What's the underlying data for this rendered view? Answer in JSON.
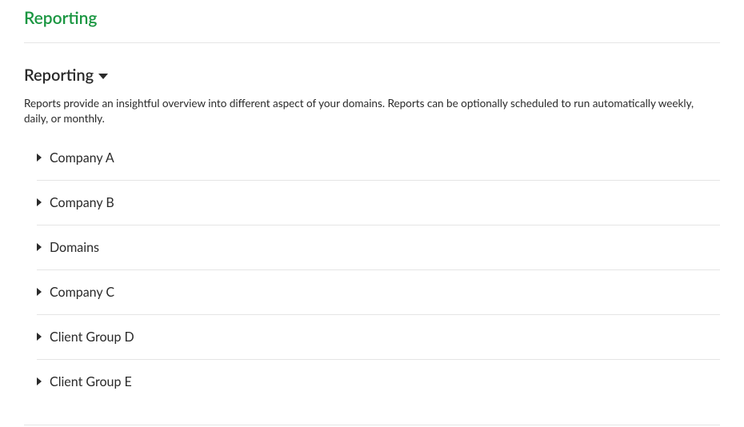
{
  "page_title": "Reporting",
  "section": {
    "title": "Reporting",
    "description": "Reports provide an insightful overview into different aspect of your domains. Reports can be optionally scheduled to run automatically weekly, daily, or monthly."
  },
  "items": [
    {
      "label": "Company A"
    },
    {
      "label": "Company B"
    },
    {
      "label": "Domains"
    },
    {
      "label": "Company C"
    },
    {
      "label": "Client Group D"
    },
    {
      "label": "Client Group E"
    }
  ]
}
